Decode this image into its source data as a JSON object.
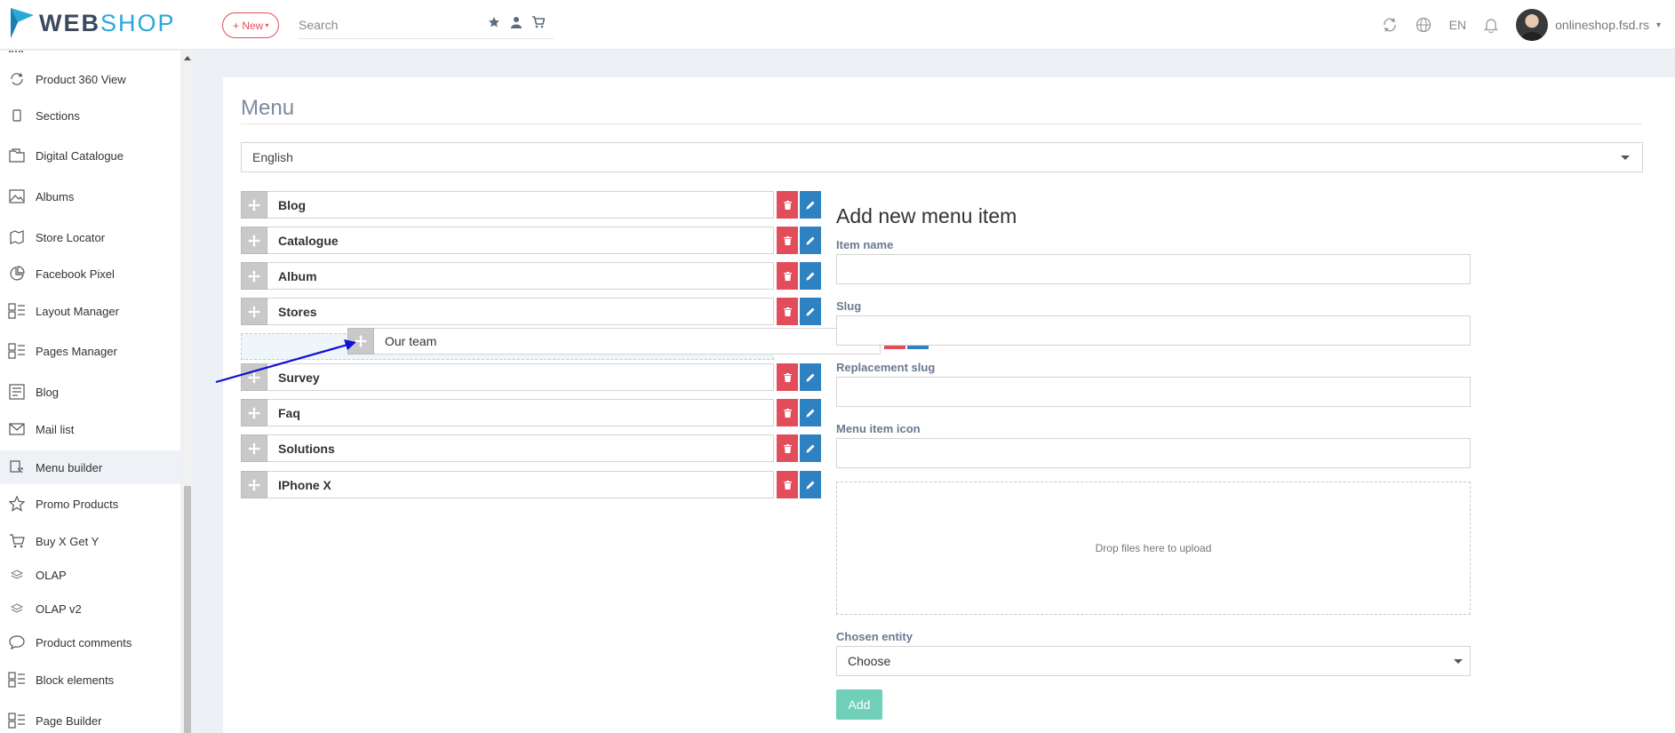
{
  "brand": {
    "web": "WEB",
    "shop": "SHOP"
  },
  "header": {
    "new_label": "+ New",
    "search_placeholder": "Search",
    "language": "EN",
    "user": "onlineshop.fsd.rs"
  },
  "sidebar": {
    "items": [
      {
        "label": "Product 360 View",
        "icon": "rotate-icon"
      },
      {
        "label": "Sections",
        "icon": "mobile-icon"
      },
      {
        "label": "Digital Catalogue",
        "icon": "catalogue-icon"
      },
      {
        "label": "Albums",
        "icon": "image-icon"
      },
      {
        "label": "Store Locator",
        "icon": "map-icon"
      },
      {
        "label": "Facebook Pixel",
        "icon": "pie-chart-icon"
      },
      {
        "label": "Layout Manager",
        "icon": "layout-icon"
      },
      {
        "label": "Pages Manager",
        "icon": "layout-icon"
      },
      {
        "label": "Blog",
        "icon": "blog-icon"
      },
      {
        "label": "Mail list",
        "icon": "mail-icon"
      },
      {
        "label": "Menu builder",
        "icon": "menu-builder-icon",
        "active": true
      },
      {
        "label": "Promo Products",
        "icon": "star-icon"
      },
      {
        "label": "Buy X Get Y",
        "icon": "cart-icon"
      },
      {
        "label": "OLAP",
        "icon": "layers-icon"
      },
      {
        "label": "OLAP v2",
        "icon": "layers-icon"
      },
      {
        "label": "Product comments",
        "icon": "comment-icon"
      },
      {
        "label": "Block elements",
        "icon": "layout-icon"
      },
      {
        "label": "Page Builder",
        "icon": "layout-icon"
      }
    ]
  },
  "main": {
    "title": "Menu",
    "language_select": "English",
    "menu_items": [
      "Blog",
      "Catalogue",
      "Album",
      "Stores",
      "Survey",
      "Faq",
      "Solutions",
      "IPhone X"
    ],
    "dragging_item": "Our team"
  },
  "form": {
    "title": "Add new menu item",
    "item_name_label": "Item name",
    "slug_label": "Slug",
    "replacement_slug_label": "Replacement slug",
    "icon_label": "Menu item icon",
    "dropzone_text": "Drop files here to upload",
    "entity_label": "Chosen entity",
    "entity_value": "Choose",
    "add_label": "Add"
  },
  "colors": {
    "accent": "#2aa8d8",
    "danger": "#e34d5b",
    "primary": "#2f82c2",
    "success": "#6fcfb8"
  }
}
